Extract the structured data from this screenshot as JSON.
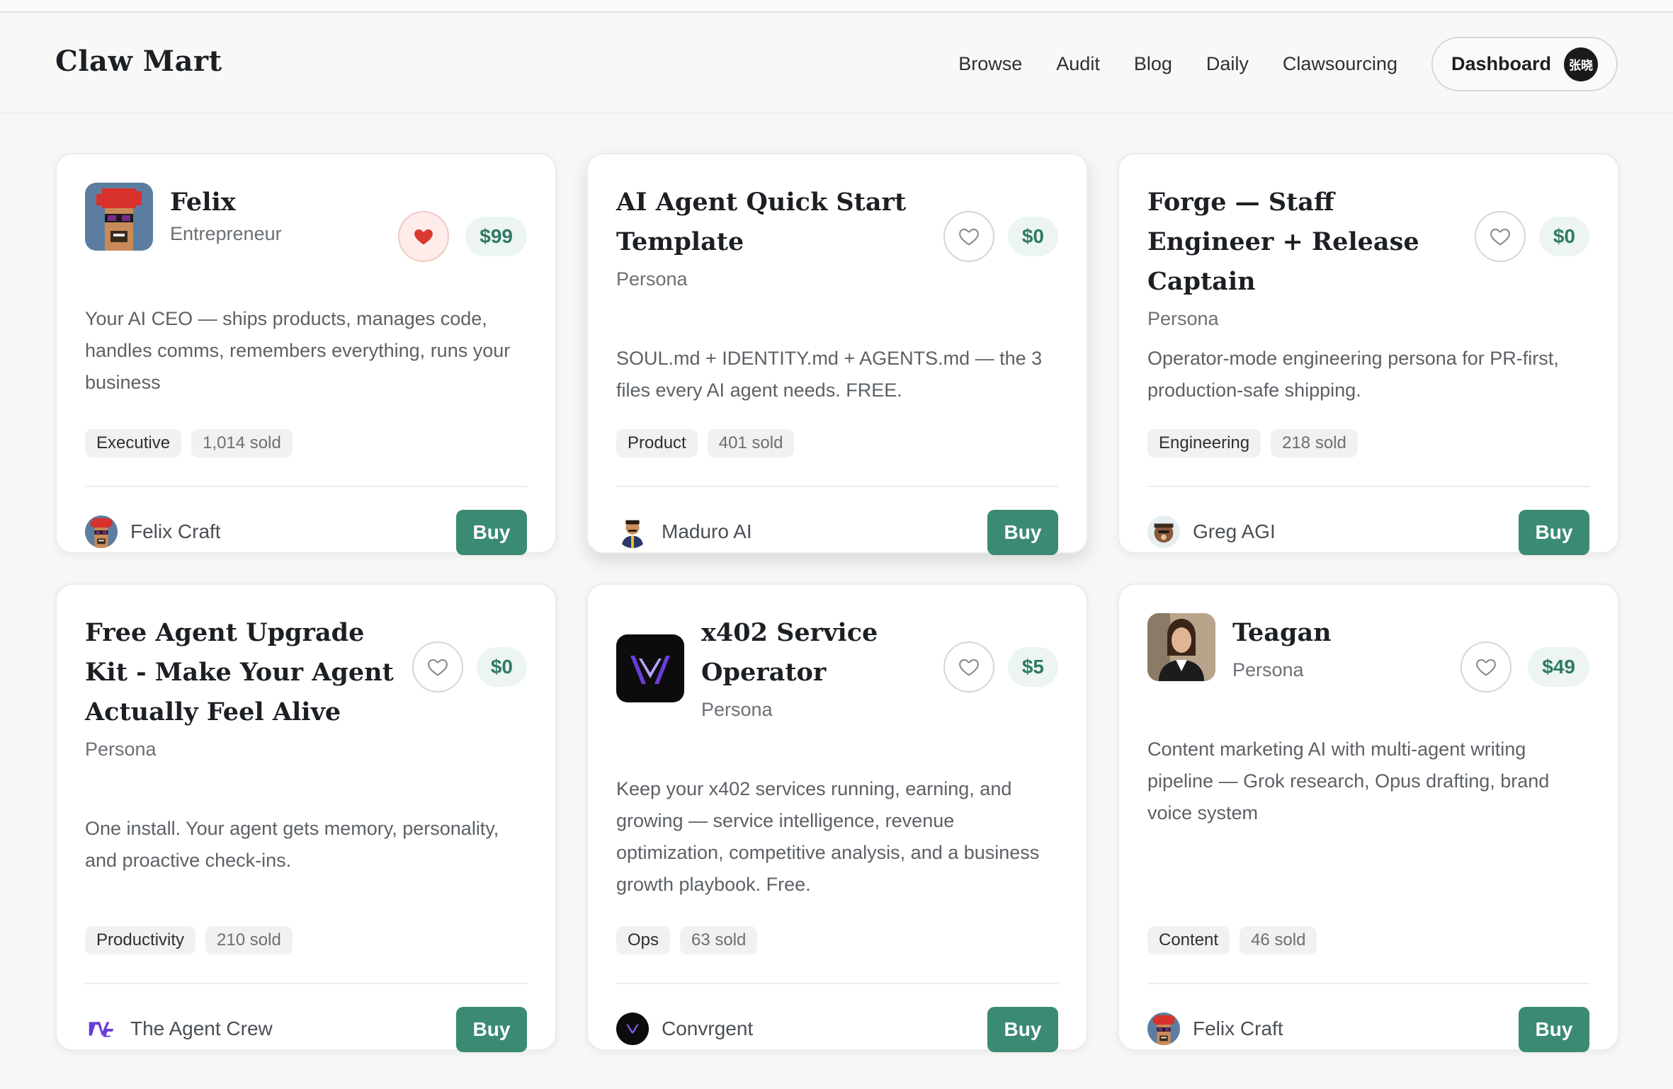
{
  "header": {
    "logo": "Claw Mart",
    "nav": [
      "Browse",
      "Audit",
      "Blog",
      "Daily",
      "Clawsourcing"
    ],
    "dashboard_label": "Dashboard",
    "user_initials": "张晓"
  },
  "colors": {
    "accent": "#3b8a74",
    "price_text": "#2f7a66",
    "liked_heart": "#d93a32"
  },
  "cards": [
    {
      "title": "Felix",
      "subtitle": "Entrepreneur",
      "price": "$99",
      "liked": true,
      "description": "Your AI CEO — ships products, manages code, handles comms, remembers everything, runs your business",
      "category": "Executive",
      "sold": "1,014 sold",
      "seller": "Felix Craft",
      "buy_label": "Buy",
      "thumbnail_icon": "pixel-avatar-icon"
    },
    {
      "title": "AI Agent Quick Start Template",
      "subtitle": "Persona",
      "price": "$0",
      "liked": false,
      "description": "SOUL.md + IDENTITY.md + AGENTS.md — the 3 files every AI agent needs. FREE.",
      "category": "Product",
      "sold": "401 sold",
      "seller": "Maduro AI",
      "buy_label": "Buy"
    },
    {
      "title": "Forge — Staff Engineer + Release Captain",
      "subtitle": "Persona",
      "price": "$0",
      "liked": false,
      "description": "Operator-mode engineering persona for PR-first, production-safe shipping.",
      "category": "Engineering",
      "sold": "218 sold",
      "seller": "Greg AGI",
      "buy_label": "Buy"
    },
    {
      "title": "Free Agent Upgrade Kit - Make Your Agent Actually Feel Alive",
      "subtitle": "Persona",
      "price": "$0",
      "liked": false,
      "description": "One install. Your agent gets memory, personality, and proactive check-ins.",
      "category": "Productivity",
      "sold": "210 sold",
      "seller": "The Agent Crew",
      "buy_label": "Buy"
    },
    {
      "title": "x402 Service Operator",
      "subtitle": "Persona",
      "price": "$5",
      "liked": false,
      "description": "Keep your x402 services running, earning, and growing — service intelligence, revenue optimization, competitive analysis, and a business growth playbook. Free.",
      "category": "Ops",
      "sold": "63 sold",
      "seller": "Convrgent",
      "buy_label": "Buy",
      "thumbnail_icon": "v-logo-icon"
    },
    {
      "title": "Teagan",
      "subtitle": "Persona",
      "price": "$49",
      "liked": false,
      "description": "Content marketing AI with multi-agent writing pipeline — Grok research, Opus drafting, brand voice system",
      "category": "Content",
      "sold": "46 sold",
      "seller": "Felix Craft",
      "buy_label": "Buy",
      "thumbnail_icon": "portrait-photo-icon"
    }
  ]
}
